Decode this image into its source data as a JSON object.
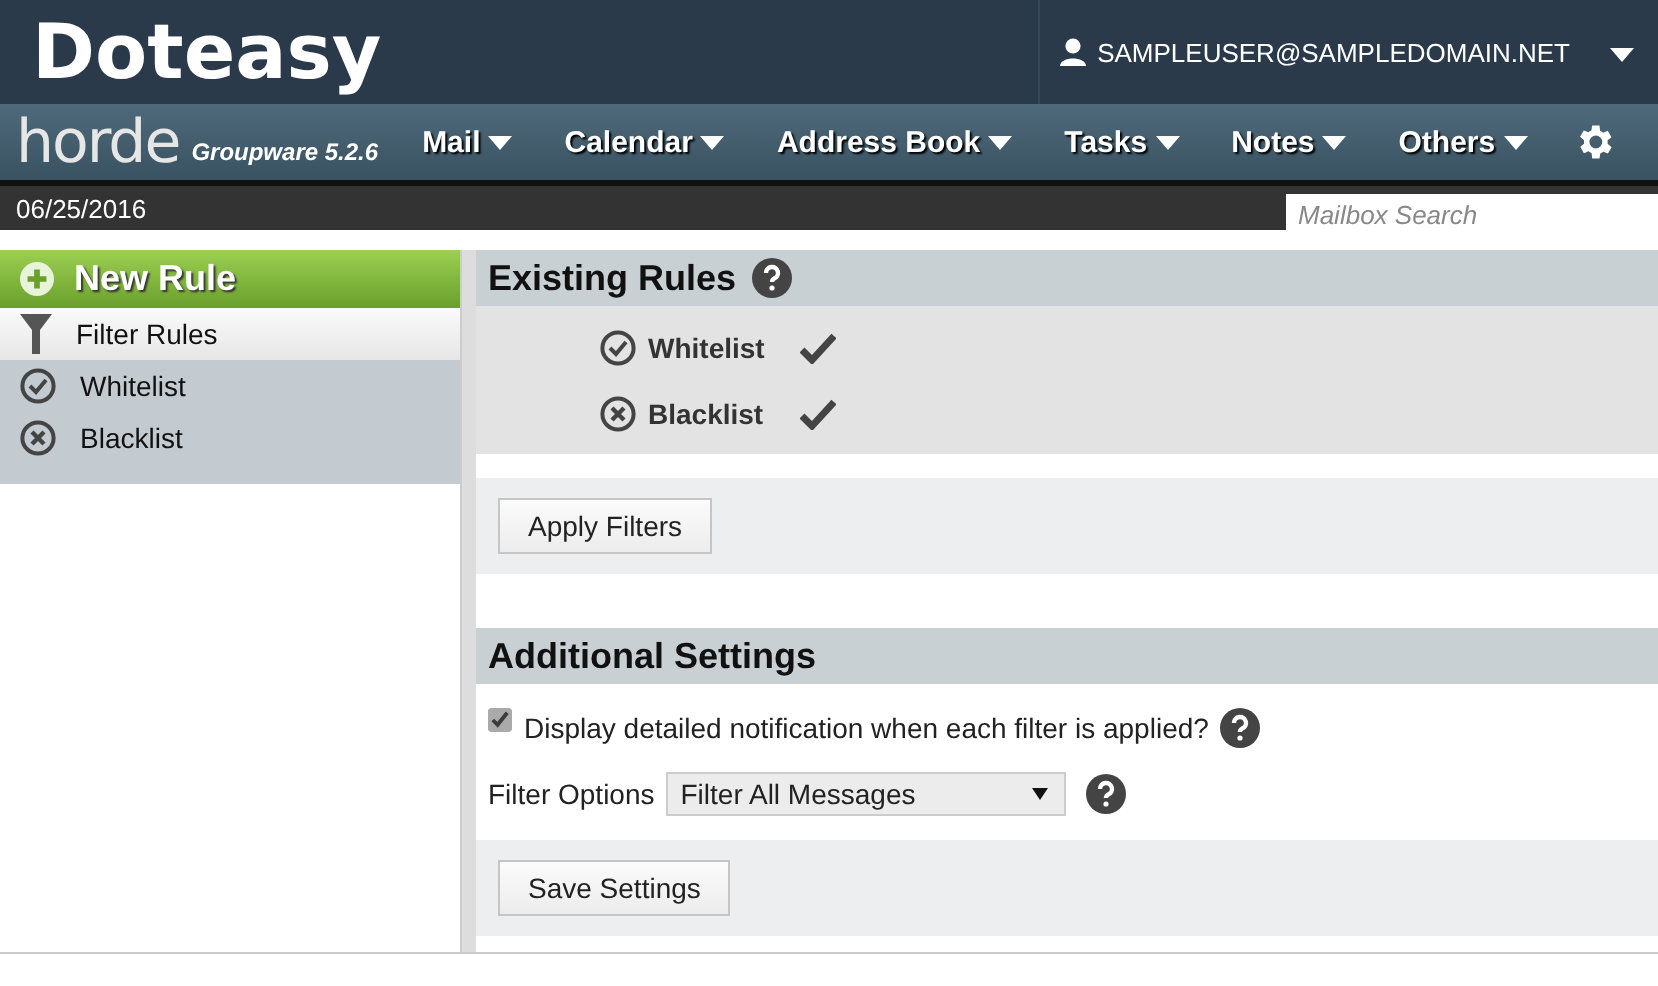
{
  "header": {
    "brand": "Doteasy",
    "user": "SAMPLEUSER@SAMPLEDOMAIN.NET"
  },
  "nav": {
    "logo": "horde",
    "version": "Groupware 5.2.6",
    "menus": [
      "Mail",
      "Calendar",
      "Address Book",
      "Tasks",
      "Notes",
      "Others"
    ]
  },
  "date_bar": {
    "date": "06/25/2016",
    "search": {
      "placeholder": "Mailbox Search"
    }
  },
  "sidebar": {
    "new_rule": "New Rule",
    "items": [
      {
        "label": "Filter Rules",
        "kind": "filter",
        "selected": true
      },
      {
        "label": "Whitelist",
        "kind": "whitelist",
        "selected": false
      },
      {
        "label": "Blacklist",
        "kind": "blacklist",
        "selected": false
      }
    ]
  },
  "existing_rules": {
    "title": "Existing Rules",
    "rules": [
      {
        "name": "Whitelist",
        "kind": "whitelist",
        "enabled": true
      },
      {
        "name": "Blacklist",
        "kind": "blacklist",
        "enabled": true
      }
    ],
    "button": "Apply Filters"
  },
  "additional_settings": {
    "title": "Additional Settings",
    "notification": {
      "label": "Display detailed notification when each filter is applied?",
      "checked": true
    },
    "filter_options": {
      "label": "Filter Options",
      "value": "Filter All Messages"
    },
    "button": "Save Settings"
  }
}
